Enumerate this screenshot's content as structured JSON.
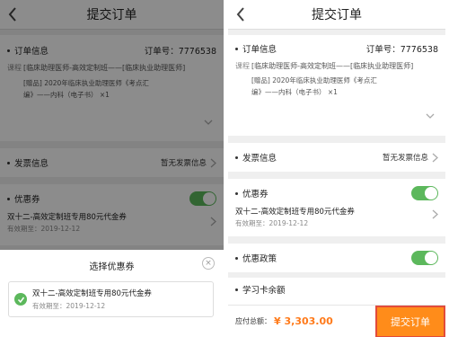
{
  "header": {
    "title": "提交订单"
  },
  "order": {
    "section_label": "订单信息",
    "order_no": "订单号：7776538",
    "course_tag": "课程",
    "course_name": "[临床助理医师-高效定制班——[临床执业助理医师]",
    "gift_line1": "[赠品] 2020年临床执业助理医师《考点汇",
    "gift_line2": "编》——内科（电子书）   ×1"
  },
  "invoice": {
    "label": "发票信息",
    "value": "暂无发票信息"
  },
  "coupon": {
    "label": "优惠券",
    "toggle_on": true,
    "name": "双十二-高效定制班专用80元代金券",
    "expiry": "有效期至：2019-12-12"
  },
  "policy": {
    "label": "优惠政策",
    "toggle_on": true
  },
  "study_card": {
    "label": "学习卡余额"
  },
  "footer": {
    "total_label": "应付总额：",
    "total_value": "¥ 3,303.00",
    "submit_label": "提交订单"
  },
  "sheet": {
    "title": "选择优惠券",
    "close_icon": "×",
    "item_name": "双十二-高效定制班专用80元代金券",
    "item_expiry": "有效期至：2019-12-12"
  },
  "colors": {
    "accent": "#ff8c1a",
    "toggle": "#5cb85c",
    "highlight_border": "#e24b3b"
  }
}
